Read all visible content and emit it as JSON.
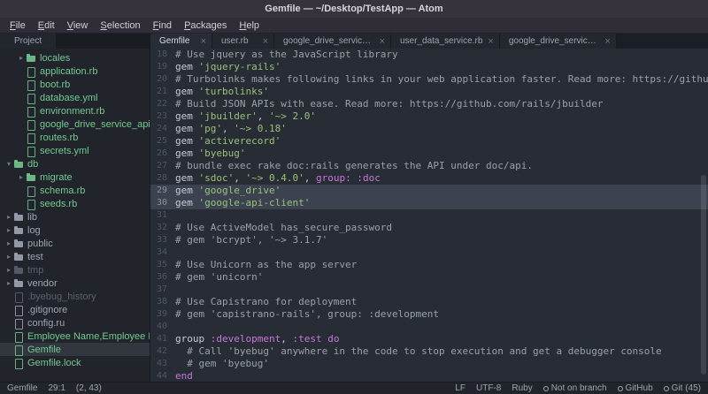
{
  "window": {
    "title": "Gemfile — ~/Desktop/TestApp — Atom"
  },
  "menu_bar": {
    "items": [
      "File",
      "Edit",
      "View",
      "Selection",
      "Find",
      "Packages",
      "Help"
    ]
  },
  "icons": {
    "chevron_collapsed": "▸",
    "chevron_expanded": "▾",
    "tab_close": "×"
  },
  "project_panel": {
    "header_label": "Project",
    "items": [
      {
        "label": "locales",
        "type": "folder",
        "expanded": false,
        "depth": 2,
        "status": "added"
      },
      {
        "label": "application.rb",
        "type": "file",
        "depth": 2,
        "status": "added"
      },
      {
        "label": "boot.rb",
        "type": "file",
        "depth": 2,
        "status": "added"
      },
      {
        "label": "database.yml",
        "type": "file",
        "depth": 2,
        "status": "added"
      },
      {
        "label": "environment.rb",
        "type": "file",
        "depth": 2,
        "status": "added"
      },
      {
        "label": "google_drive_service_api_key.json",
        "type": "file",
        "depth": 2,
        "status": "added"
      },
      {
        "label": "routes.rb",
        "type": "file",
        "depth": 2,
        "status": "added"
      },
      {
        "label": "secrets.yml",
        "type": "file",
        "depth": 2,
        "status": "added"
      },
      {
        "label": "db",
        "type": "folder",
        "expanded": true,
        "depth": 1,
        "status": "added"
      },
      {
        "label": "migrate",
        "type": "folder",
        "expanded": false,
        "depth": 2,
        "status": "added"
      },
      {
        "label": "schema.rb",
        "type": "file",
        "depth": 2,
        "status": "added"
      },
      {
        "label": "seeds.rb",
        "type": "file",
        "depth": 2,
        "status": "added"
      },
      {
        "label": "lib",
        "type": "folder",
        "expanded": false,
        "depth": 1,
        "status": "default"
      },
      {
        "label": "log",
        "type": "folder",
        "expanded": false,
        "depth": 1,
        "status": "default"
      },
      {
        "label": "public",
        "type": "folder",
        "expanded": false,
        "depth": 1,
        "status": "default"
      },
      {
        "label": "test",
        "type": "folder",
        "expanded": false,
        "depth": 1,
        "status": "default"
      },
      {
        "label": "tmp",
        "type": "folder",
        "expanded": false,
        "depth": 1,
        "status": "ignored"
      },
      {
        "label": "vendor",
        "type": "folder",
        "expanded": false,
        "depth": 1,
        "status": "default"
      },
      {
        "label": ".byebug_history",
        "type": "file",
        "depth": 1,
        "status": "ignored"
      },
      {
        "label": ".gitignore",
        "type": "file",
        "depth": 1,
        "status": "default"
      },
      {
        "label": "config.ru",
        "type": "file",
        "depth": 1,
        "status": "default"
      },
      {
        "label": "Employee Name,Employee Email,Qualif",
        "type": "file",
        "depth": 1,
        "status": "added"
      },
      {
        "label": "Gemfile",
        "type": "file",
        "depth": 1,
        "status": "added",
        "selected": true
      },
      {
        "label": "Gemfile.lock",
        "type": "file",
        "depth": 1,
        "status": "added"
      }
    ]
  },
  "tab_bar": {
    "tabs": [
      {
        "label": "Gemfile",
        "active": true
      },
      {
        "label": "user.rb",
        "active": false
      },
      {
        "label": "google_drive_service_api_k...",
        "active": false
      },
      {
        "label": "user_data_service.rb",
        "active": false
      },
      {
        "label": "google_drive_service.rb",
        "active": false
      }
    ]
  },
  "editor": {
    "language": "Ruby",
    "selected_lines": [
      29,
      30
    ],
    "lines": [
      {
        "num": 18,
        "tokens": [
          [
            "c",
            "# Use jquery as the JavaScript library"
          ]
        ]
      },
      {
        "num": 19,
        "tokens": [
          [
            "p",
            "gem "
          ],
          [
            "s",
            "'jquery-rails'"
          ]
        ]
      },
      {
        "num": 20,
        "tokens": [
          [
            "c",
            "# Turbolinks makes following links in your web application faster. Read more: https://github.com/rails/turbolinks"
          ]
        ]
      },
      {
        "num": 21,
        "tokens": [
          [
            "p",
            "gem "
          ],
          [
            "s",
            "'turbolinks'"
          ]
        ]
      },
      {
        "num": 22,
        "tokens": [
          [
            "c",
            "# Build JSON APIs with ease. Read more: https://github.com/rails/jbuilder"
          ]
        ]
      },
      {
        "num": 23,
        "tokens": [
          [
            "p",
            "gem "
          ],
          [
            "s",
            "'jbuilder'"
          ],
          [
            "p",
            ", "
          ],
          [
            "s",
            "'~> 2.0'"
          ]
        ]
      },
      {
        "num": 24,
        "tokens": [
          [
            "p",
            "gem "
          ],
          [
            "s",
            "'pg'"
          ],
          [
            "p",
            ", "
          ],
          [
            "s",
            "'~> 0.18'"
          ]
        ]
      },
      {
        "num": 25,
        "tokens": [
          [
            "p",
            "gem "
          ],
          [
            "s",
            "'activerecord'"
          ]
        ]
      },
      {
        "num": 26,
        "tokens": [
          [
            "p",
            "gem "
          ],
          [
            "s",
            "'byebug'"
          ]
        ]
      },
      {
        "num": 27,
        "tokens": [
          [
            "c",
            "# bundle exec rake doc:rails generates the API under doc/api."
          ]
        ]
      },
      {
        "num": 28,
        "tokens": [
          [
            "p",
            "gem "
          ],
          [
            "s",
            "'sdoc'"
          ],
          [
            "p",
            ", "
          ],
          [
            "s",
            "'~> 0.4.0'"
          ],
          [
            "p",
            ", "
          ],
          [
            "k",
            "group: :doc"
          ]
        ]
      },
      {
        "num": 29,
        "tokens": [
          [
            "p",
            "gem "
          ],
          [
            "s",
            "'google_drive'"
          ]
        ]
      },
      {
        "num": 30,
        "tokens": [
          [
            "p",
            "gem "
          ],
          [
            "s",
            "'google-api-client'"
          ]
        ]
      },
      {
        "num": 31,
        "tokens": []
      },
      {
        "num": 32,
        "tokens": [
          [
            "c",
            "# Use ActiveModel has_secure_password"
          ]
        ]
      },
      {
        "num": 33,
        "tokens": [
          [
            "c",
            "# gem 'bcrypt', '~> 3.1.7'"
          ]
        ]
      },
      {
        "num": 34,
        "tokens": []
      },
      {
        "num": 35,
        "tokens": [
          [
            "c",
            "# Use Unicorn as the app server"
          ]
        ]
      },
      {
        "num": 36,
        "tokens": [
          [
            "c",
            "# gem 'unicorn'"
          ]
        ]
      },
      {
        "num": 37,
        "tokens": []
      },
      {
        "num": 38,
        "tokens": [
          [
            "c",
            "# Use Capistrano for deployment"
          ]
        ]
      },
      {
        "num": 39,
        "tokens": [
          [
            "c",
            "# gem 'capistrano-rails', group: :development"
          ]
        ]
      },
      {
        "num": 40,
        "tokens": []
      },
      {
        "num": 41,
        "tokens": [
          [
            "p",
            "group "
          ],
          [
            "k",
            ":development"
          ],
          [
            "p",
            ", "
          ],
          [
            "k",
            ":test"
          ],
          [
            "p",
            " "
          ],
          [
            "k",
            "do"
          ]
        ]
      },
      {
        "num": 42,
        "tokens": [
          [
            "c",
            "  # Call 'byebug' anywhere in the code to stop execution and get a debugger console"
          ]
        ]
      },
      {
        "num": 43,
        "tokens": [
          [
            "c",
            "  # gem 'byebug'"
          ]
        ]
      },
      {
        "num": 44,
        "tokens": [
          [
            "k",
            "end"
          ]
        ]
      }
    ]
  },
  "status_bar": {
    "left": [
      {
        "label": "Gemfile"
      },
      {
        "label": "29:1"
      },
      {
        "label": "(2, 43)"
      }
    ],
    "right": [
      {
        "label": "LF"
      },
      {
        "label": "UTF-8"
      },
      {
        "label": "Ruby"
      },
      {
        "label": "Not on branch",
        "icon": "branch-icon"
      },
      {
        "label": "GitHub",
        "icon": "github-icon"
      },
      {
        "label": "Git (45)",
        "icon": "git-icon"
      }
    ]
  },
  "colors": {
    "string_green": "#98c379",
    "symbol_purple": "#c678dd",
    "comment_gray": "#9aa1ad",
    "git_added_green": "#73c990",
    "selection_bg": "#3c4250",
    "editor_bg": "#282c34",
    "panel_bg": "#21252b"
  }
}
